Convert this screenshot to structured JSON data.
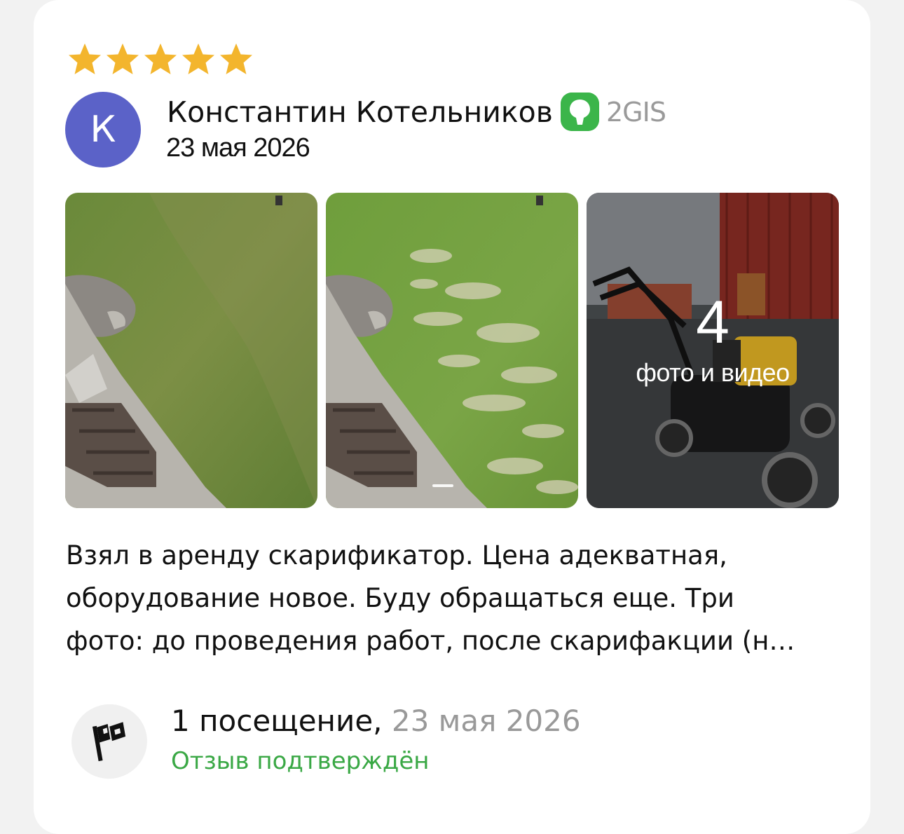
{
  "review": {
    "rating": 5,
    "rating_max": 5,
    "star_color": "#f3b52d",
    "author": {
      "initial": "К",
      "name": "Константин Котельников",
      "avatar_color": "#5b62c8"
    },
    "source": {
      "name": "2GIS",
      "logo_icon": "2gis-logo-icon",
      "logo_color": "#3bb54a"
    },
    "date": "23 мая 2026",
    "photos": {
      "items": [
        {
          "description": "lawn-before"
        },
        {
          "description": "lawn-after-scarification"
        },
        {
          "description": "lawn-mower-scarifier"
        }
      ],
      "more_count": "4",
      "more_label": "фото и видео"
    },
    "text": "Взял в аренду скарификатор. Цена адекватная,\nоборудование новое. Буду обращаться еще. Три\nфото: до проведения работ, после скарифакции (н…",
    "visit": {
      "icon": "flag-icon",
      "count_text": "1 посещение,",
      "date": " 23 мая 2026",
      "verified": "Отзыв подтверждён",
      "verified_color": "#3aa845"
    }
  }
}
